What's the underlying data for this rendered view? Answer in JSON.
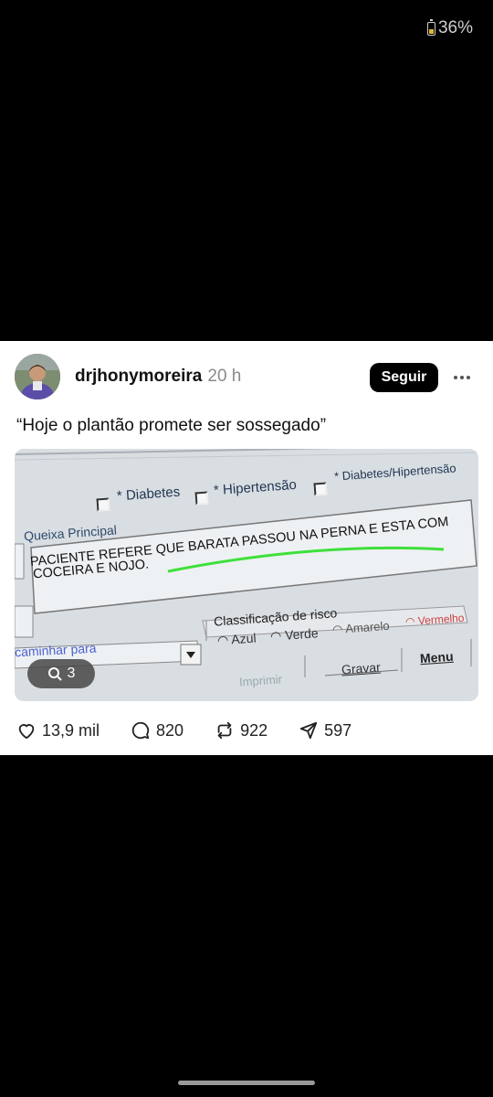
{
  "status_bar": {
    "battery": "36%"
  },
  "post": {
    "username": "drjhonymoreira",
    "time": "20 h",
    "follow_label": "Seguir",
    "caption": "“Hoje o plantão promete ser sossegado”",
    "image_counter": "3",
    "screen": {
      "checkbox_diabetes": "* Diabetes",
      "checkbox_hipertensao": "* Hipertensão",
      "checkbox_diab_hiper": "* Diabetes/Hipertensão",
      "queixa_label": "Queixa Principal",
      "queixa_line1": "PACIENTE REFERE QUE BARATA PASSOU NA PERNA E ESTA COM",
      "queixa_line2": "COCEIRA E NOJO.",
      "classificacao_label": "Classificação de risco",
      "risk_azul": "Azul",
      "risk_verde": "Verde",
      "risk_amarelo": "Amarelo",
      "risk_vermelho": "Vermelho",
      "encaminhar_label": "caminhar para",
      "btn_imprimir": "Imprimir",
      "btn_gravar": "Gravar",
      "btn_menu": "Menu"
    },
    "actions": {
      "likes": "13,9 mil",
      "comments": "820",
      "reposts": "922",
      "shares": "597"
    },
    "colors": {
      "highlight_line": "#3ee03a",
      "risk_red": "#e04040"
    }
  }
}
